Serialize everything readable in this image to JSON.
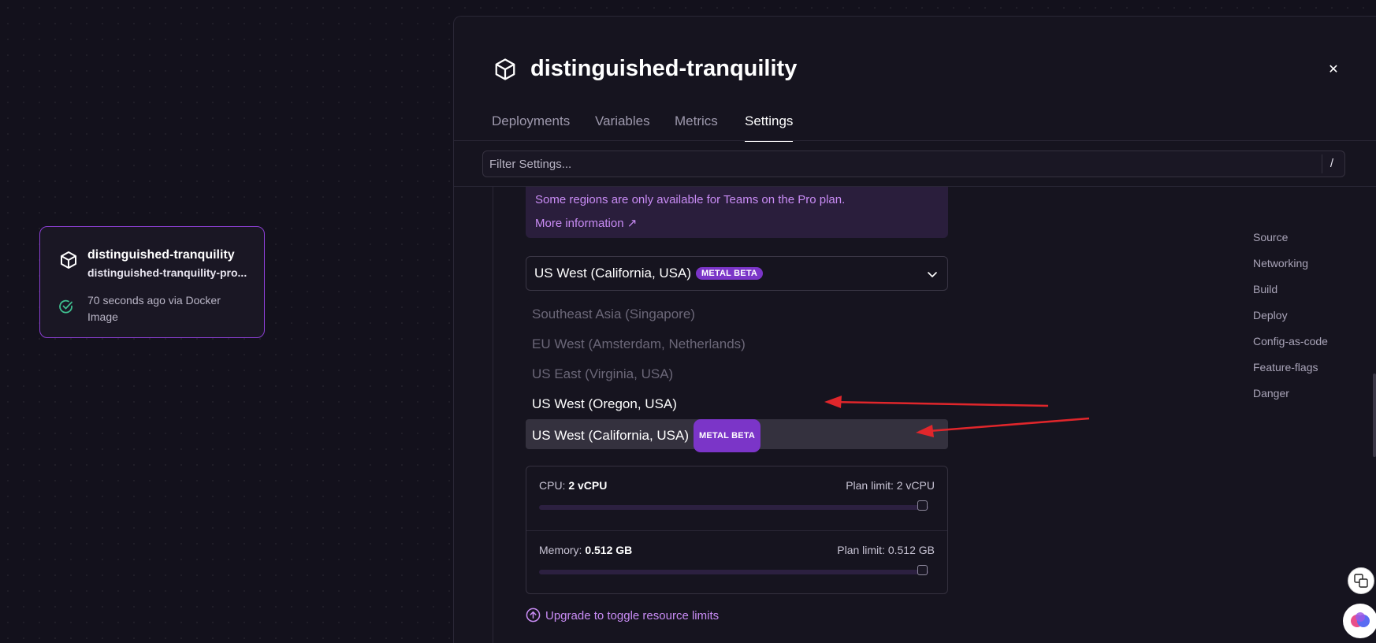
{
  "card": {
    "title": "distinguished-tranquility",
    "domain": "distinguished-tranquility-pro...",
    "status": "70 seconds ago via Docker Image"
  },
  "panel": {
    "title": "distinguished-tranquility",
    "tabs": [
      {
        "label": "Deployments"
      },
      {
        "label": "Variables"
      },
      {
        "label": "Metrics"
      },
      {
        "label": "Settings"
      }
    ],
    "active_tab": "Settings",
    "filter": {
      "placeholder": "Filter Settings...",
      "shortcut": "/"
    }
  },
  "notice": {
    "text": "Some regions are only available for Teams on the Pro plan.",
    "link": "More information ↗"
  },
  "region_select": {
    "value": "US West (California, USA)",
    "badge": "METAL BETA"
  },
  "region_options": [
    {
      "label": "Southeast Asia (Singapore)",
      "state": "disabled"
    },
    {
      "label": "EU West (Amsterdam, Netherlands)",
      "state": "disabled"
    },
    {
      "label": "US East (Virginia, USA)",
      "state": "disabled"
    },
    {
      "label": "US West (Oregon, USA)",
      "state": "enabled"
    },
    {
      "label": "US West (California, USA)",
      "state": "selected",
      "badge": "METAL BETA"
    }
  ],
  "resources": {
    "cpu": {
      "label": "CPU:",
      "value": "2 vCPU",
      "limit": "Plan limit: 2 vCPU",
      "fill": 1.0
    },
    "memory": {
      "label": "Memory:",
      "value": "0.512 GB",
      "limit": "Plan limit: 0.512 GB",
      "fill": 1.0
    },
    "upgrade": "Upgrade to toggle resource limits"
  },
  "right_nav": [
    "Source",
    "Networking",
    "Build",
    "Deploy",
    "Config-as-code",
    "Feature-flags",
    "Danger"
  ],
  "colors": {
    "accent": "#8a3fd1",
    "badge": "#7b35c8",
    "link": "#c98cf5",
    "arrow": "#e0262b",
    "success": "#3fbf8f"
  }
}
